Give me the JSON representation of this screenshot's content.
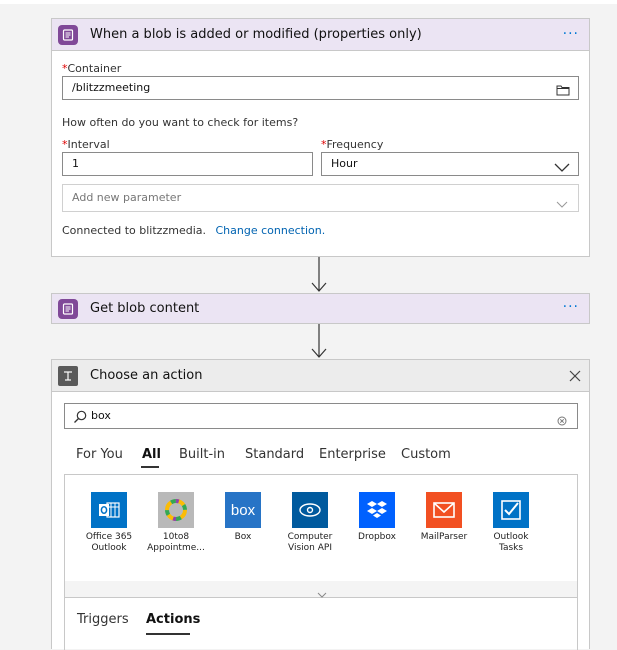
{
  "trigger": {
    "title": "When a blob is added or modified (properties only)",
    "more_label": "···",
    "container_label": "Container",
    "container_value": "/blitzzmeeting",
    "question": "How often do you want to check for items?",
    "interval_label": "Interval",
    "interval_value": "1",
    "frequency_label": "Frequency",
    "frequency_value": "Hour",
    "add_param_placeholder": "Add new parameter",
    "connected_text": "Connected to blitzzmedia.",
    "change_connection": "Change connection.",
    "required_mark": "*"
  },
  "get_blob": {
    "title": "Get blob content",
    "more_label": "···"
  },
  "choose_action": {
    "title": "Choose an action",
    "search_value": "box",
    "tabs": [
      "For You",
      "All",
      "Built-in",
      "Standard",
      "Enterprise",
      "Custom"
    ],
    "active_tab": "All",
    "connectors": [
      {
        "name": "Office 365 Outlook",
        "line1": "Office 365",
        "line2": "Outlook",
        "color": "#0072c6",
        "icon": "outlook-icon"
      },
      {
        "name": "10to8 Appointme...",
        "line1": "10to8",
        "line2": "Appointme...",
        "color": "#b9b9b9",
        "icon": "ring-icon"
      },
      {
        "name": "Box",
        "line1": "Box",
        "line2": "",
        "color": "#2774c6",
        "icon": "box-icon"
      },
      {
        "name": "Computer Vision API",
        "line1": "Computer",
        "line2": "Vision API",
        "color": "#005a9e",
        "icon": "eye-icon"
      },
      {
        "name": "Dropbox",
        "line1": "Dropbox",
        "line2": "",
        "color": "#0061fe",
        "icon": "dropbox-icon"
      },
      {
        "name": "MailParser",
        "line1": "MailParser",
        "line2": "",
        "color": "#f25022",
        "icon": "envelope-icon"
      },
      {
        "name": "Outlook Tasks",
        "line1": "Outlook",
        "line2": "Tasks",
        "color": "#0072c6",
        "icon": "checkbox-icon"
      }
    ],
    "bottom_tabs": [
      "Triggers",
      "Actions"
    ],
    "active_bottom_tab": "Actions"
  }
}
